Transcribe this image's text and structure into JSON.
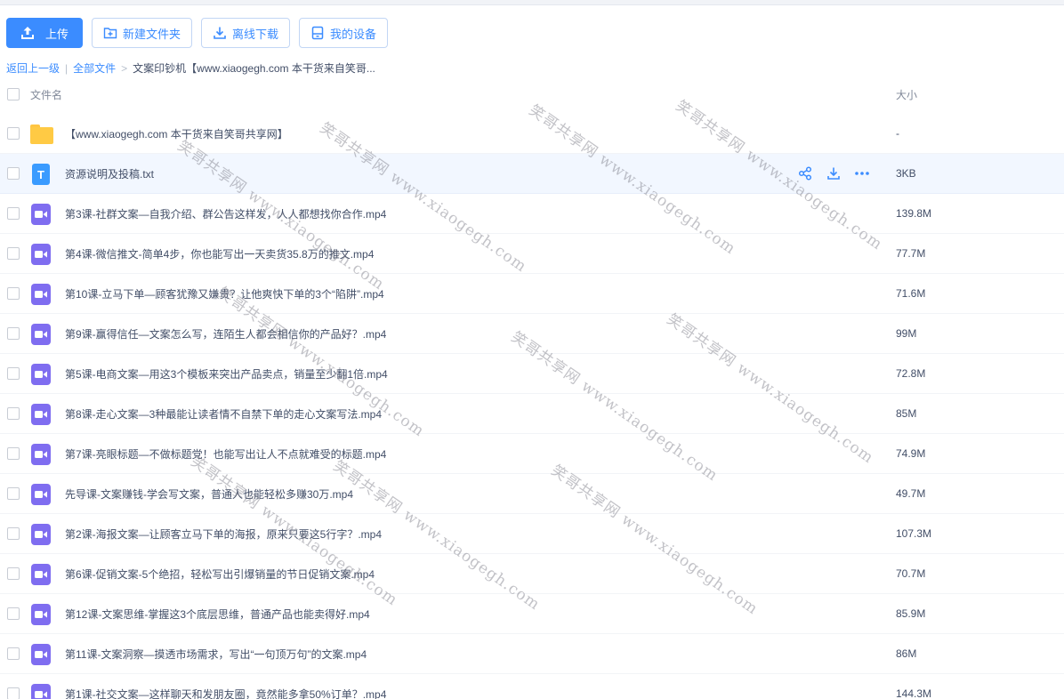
{
  "toolbar": {
    "upload": "上传",
    "new_folder": "新建文件夹",
    "offline_download": "离线下载",
    "my_devices": "我的设备"
  },
  "breadcrumb": {
    "back": "返回上一级",
    "separator_1": "|",
    "all_files": "全部文件",
    "separator_2": ">",
    "current": "文案印钞机【www.xiaogegh.com 本干货来自笑哥..."
  },
  "table": {
    "header_name": "文件名",
    "header_size": "大小"
  },
  "files": [
    {
      "name": "【www.xiaogegh.com 本干货来自笑哥共享网】",
      "size": "-",
      "type": "folder"
    },
    {
      "name": "资源说明及投稿.txt",
      "size": "3KB",
      "type": "txt"
    },
    {
      "name": "第3课-社群文案—自我介绍、群公告这样发，人人都想找你合作.mp4",
      "size": "139.8M",
      "type": "video"
    },
    {
      "name": "第4课-微信推文-简单4步，你也能写出一天卖货35.8万的推文.mp4",
      "size": "77.7M",
      "type": "video"
    },
    {
      "name": "第10课-立马下单—顾客犹豫又嫌贵？让他爽快下单的3个“陷阱”.mp4",
      "size": "71.6M",
      "type": "video"
    },
    {
      "name": "第9课-赢得信任—文案怎么写，连陌生人都会相信你的产品好？.mp4",
      "size": "99M",
      "type": "video"
    },
    {
      "name": "第5课-电商文案—用这3个模板来突出产品卖点，销量至少翻1倍.mp4",
      "size": "72.8M",
      "type": "video"
    },
    {
      "name": "第8课-走心文案—3种最能让读者情不自禁下单的走心文案写法.mp4",
      "size": "85M",
      "type": "video"
    },
    {
      "name": "第7课-亮眼标题—不做标题党！也能写出让人不点就难受的标题.mp4",
      "size": "74.9M",
      "type": "video"
    },
    {
      "name": "先导课-文案赚钱-学会写文案，普通人也能轻松多赚30万.mp4",
      "size": "49.7M",
      "type": "video"
    },
    {
      "name": "第2课-海报文案—让顾客立马下单的海报，原来只要这5行字？.mp4",
      "size": "107.3M",
      "type": "video"
    },
    {
      "name": "第6课-促销文案-5个绝招，轻松写出引爆销量的节日促销文案.mp4",
      "size": "70.7M",
      "type": "video"
    },
    {
      "name": "第12课-文案思维-掌握这3个底层思维，普通产品也能卖得好.mp4",
      "size": "85.9M",
      "type": "video"
    },
    {
      "name": "第11课-文案洞察—摸透市场需求，写出“一句顶万句”的文案.mp4",
      "size": "86M",
      "type": "video"
    },
    {
      "name": "第1课-社交文案—这样聊天和发朋友圈，竟然能多拿50%订单？.mp4",
      "size": "144.3M",
      "type": "video"
    }
  ],
  "watermark": "笑哥共享网 www.xiaogegh.com",
  "colors": {
    "accent": "#3b8cff",
    "folder": "#ffca44",
    "txt_icon": "#3a9bff",
    "video_icon": "#7f6df0",
    "row_highlight": "#f2f7ff"
  }
}
